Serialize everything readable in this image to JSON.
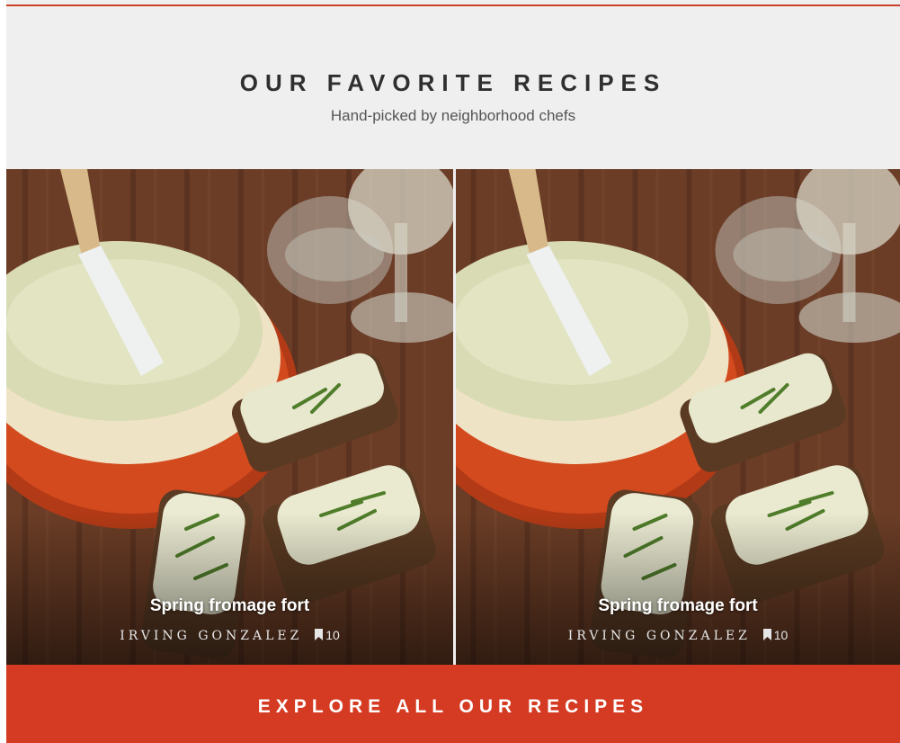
{
  "section": {
    "title": "OUR FAVORITE RECIPES",
    "subtitle": "Hand-picked by neighborhood chefs"
  },
  "cards": [
    {
      "title": "Spring fromage fort",
      "author": "IRVING GONZALEZ",
      "bookmarks": "10",
      "image": "recipe-photo-fromage-fort"
    },
    {
      "title": "Spring fromage fort",
      "author": "IRVING GONZALEZ",
      "bookmarks": "10",
      "image": "recipe-photo-fromage-fort"
    }
  ],
  "cta": {
    "label": "EXPLORE ALL OUR RECIPES"
  },
  "colors": {
    "accent": "#d53a22",
    "background": "#efefef",
    "title_text": "#2f2f2f"
  },
  "icons": {
    "bookmark": "bookmark-icon"
  }
}
